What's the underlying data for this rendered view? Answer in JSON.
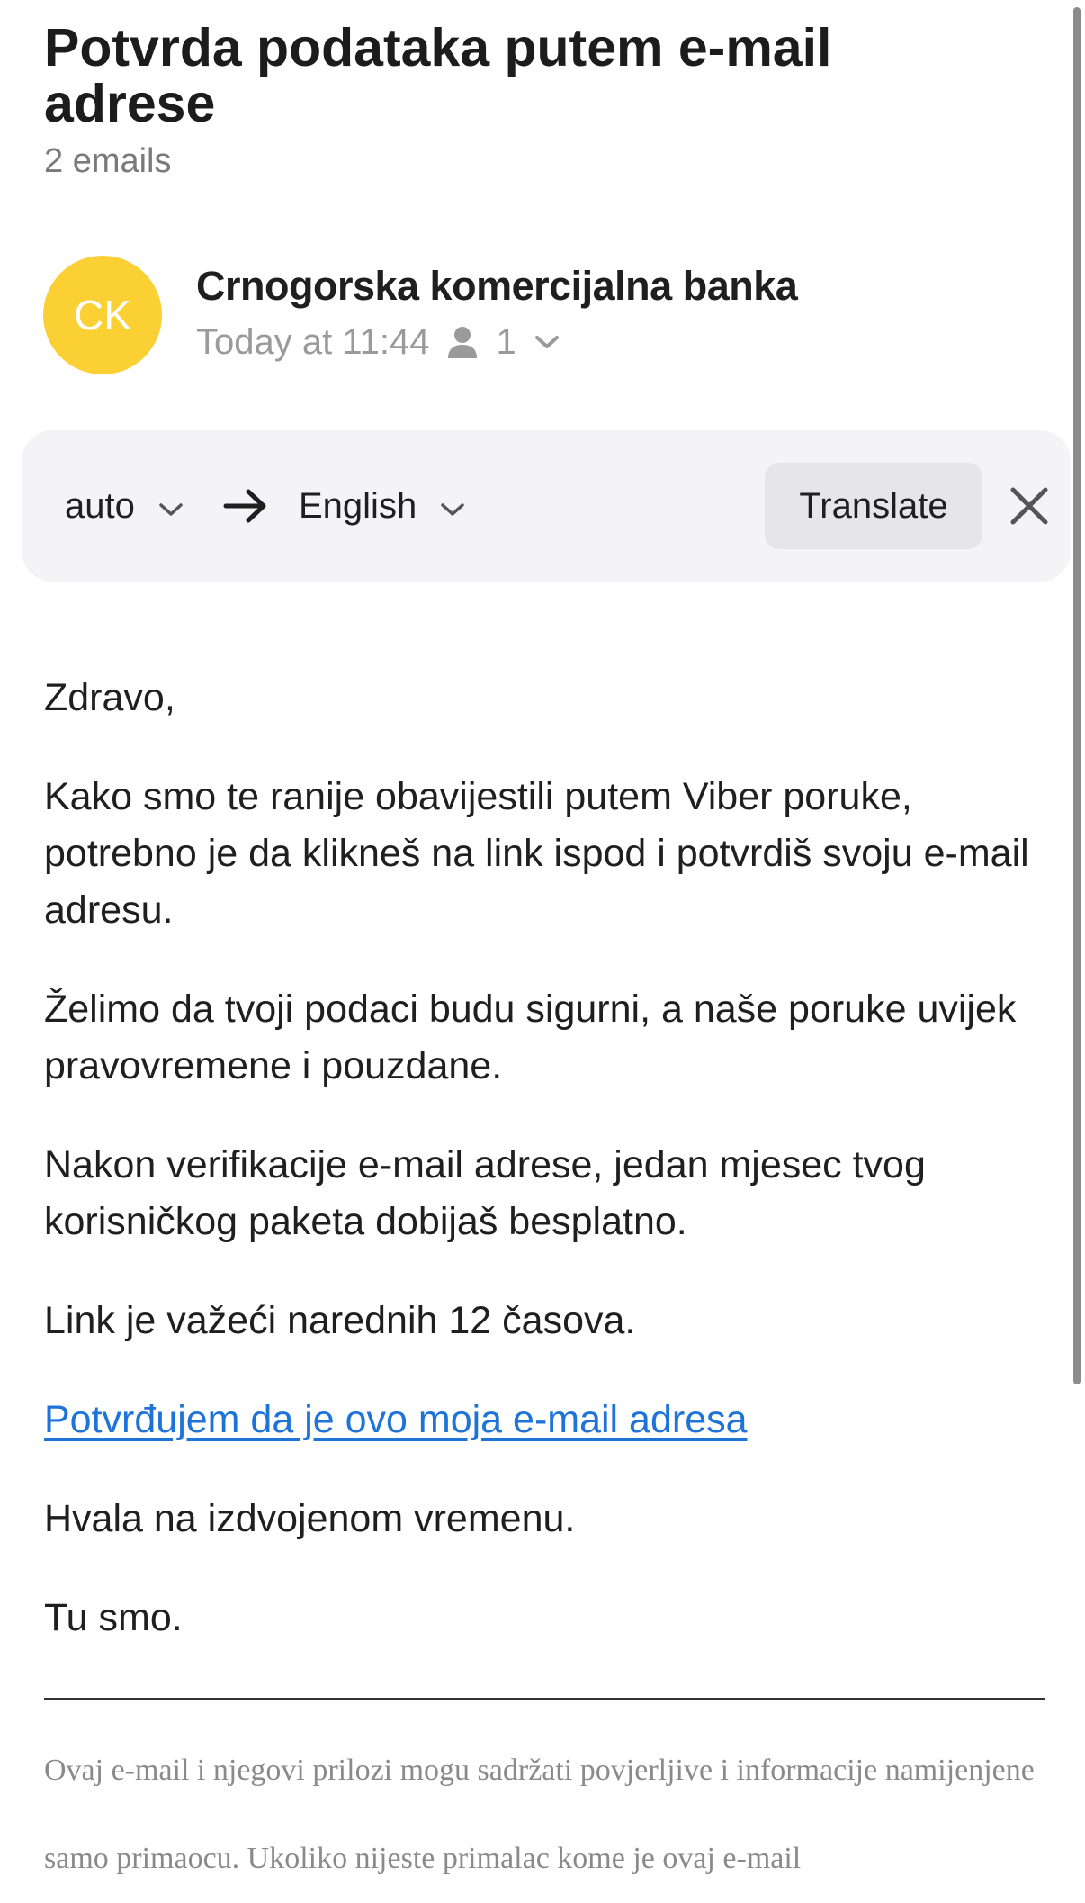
{
  "email": {
    "subject": "Potvrda podataka putem e-mail adrese",
    "count_label": "2 emails"
  },
  "sender": {
    "initials": "CK",
    "avatar_color": "#fbd034",
    "name": "Crnogorska komercijalna banka",
    "time": "Today at 11:44",
    "recipients_icon": "person-icon",
    "recipients_count": "1",
    "expand_icon": "chevron-down-icon"
  },
  "translate": {
    "source_lang": "auto",
    "target_lang": "English",
    "arrow_icon": "arrow-right-icon",
    "button_label": "Translate",
    "close_icon": "close-icon"
  },
  "body": {
    "greeting": "Zdravo,",
    "paragraph_1": "Kako smo te ranije obavijestili putem Viber poruke, potrebno je da klikneš na link ispod i potvrdiš svoju e-mail adresu.",
    "paragraph_2": "Želimo da tvoji podaci budu sigurni, a naše poruke uvijek pravovremene i pouzdane.",
    "paragraph_3": "Nakon verifikacije e-mail adrese, jedan mjesec tvog korisničkog paketa dobijaš besplatno.",
    "paragraph_4": "Link je važeći narednih 12 časova.",
    "link_text": "Potvrđujem da je ovo moja e-mail adresa",
    "link_color": "#1e73d8",
    "thanks": "Hvala na izdvojenom vremenu.",
    "signoff": "Tu smo."
  },
  "footer": {
    "disclaimer": "Ovaj e-mail i njegovi prilozi mogu sadržati povjerljive i informacije namijenjene samo primaocu. Ukoliko nijeste primalac kome je ovaj e-mail"
  }
}
